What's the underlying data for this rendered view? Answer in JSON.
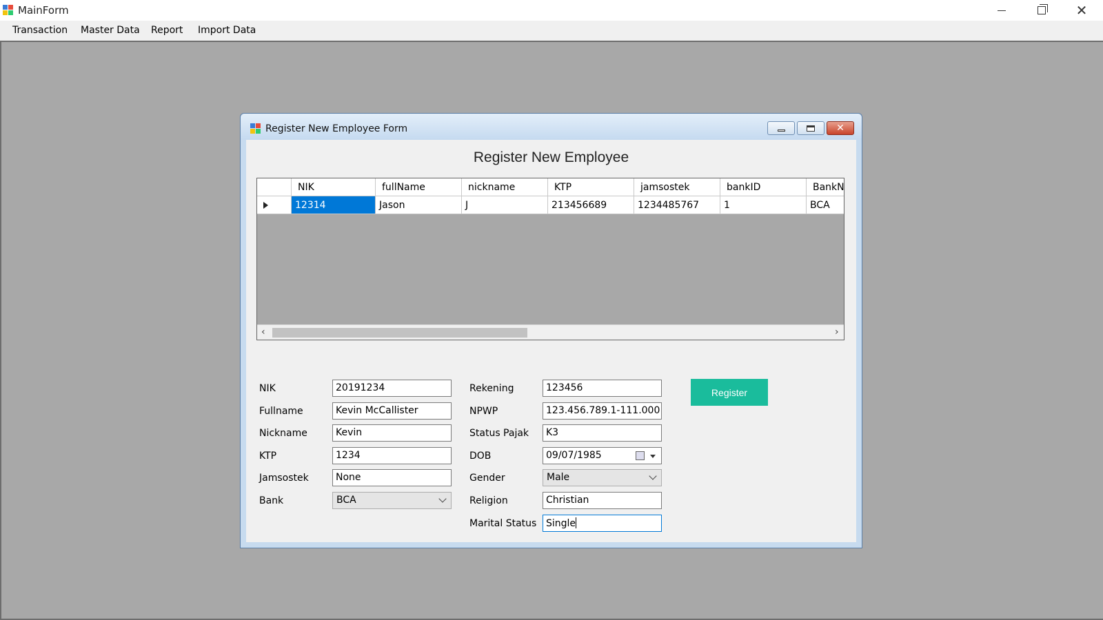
{
  "main_window": {
    "title": "MainForm",
    "menu": [
      "Transaction",
      "Master Data",
      "Report",
      "Import Data"
    ]
  },
  "child_window": {
    "title": "Register New Employee Form",
    "heading": "Register New Employee",
    "close_glyph": "✕"
  },
  "grid": {
    "columns": [
      "NIK",
      "fullName",
      "nickname",
      "KTP",
      "jamsostek",
      "bankID",
      "BankN"
    ],
    "rows": [
      [
        "12314",
        "Jason",
        "J",
        "213456689",
        "1234485767",
        "1",
        "BCA"
      ]
    ]
  },
  "form": {
    "left": [
      {
        "label": "NIK",
        "value": "20191234",
        "type": "text"
      },
      {
        "label": "Fullname",
        "value": "Kevin McCallister",
        "type": "text"
      },
      {
        "label": "Nickname",
        "value": "Kevin",
        "type": "text"
      },
      {
        "label": "KTP",
        "value": "1234",
        "type": "text"
      },
      {
        "label": "Jamsostek",
        "value": "None",
        "type": "text"
      },
      {
        "label": "Bank",
        "value": "BCA",
        "type": "combo"
      }
    ],
    "right": [
      {
        "label": "Rekening",
        "value": "123456",
        "type": "text"
      },
      {
        "label": "NPWP",
        "value": "123.456.789.1-111.000",
        "type": "text"
      },
      {
        "label": "Status Pajak",
        "value": "K3",
        "type": "text"
      },
      {
        "label": "DOB",
        "value": "09/07/1985",
        "type": "date"
      },
      {
        "label": "Gender",
        "value": "Male",
        "type": "combo"
      },
      {
        "label": "Religion",
        "value": "Christian",
        "type": "text"
      },
      {
        "label": "Marital Status",
        "value": "Single",
        "type": "text"
      }
    ],
    "register_label": "Register"
  },
  "colors": {
    "register_button": "#1abc9c",
    "selection": "#0078d7",
    "mdi_background": "#a8a8a8"
  }
}
